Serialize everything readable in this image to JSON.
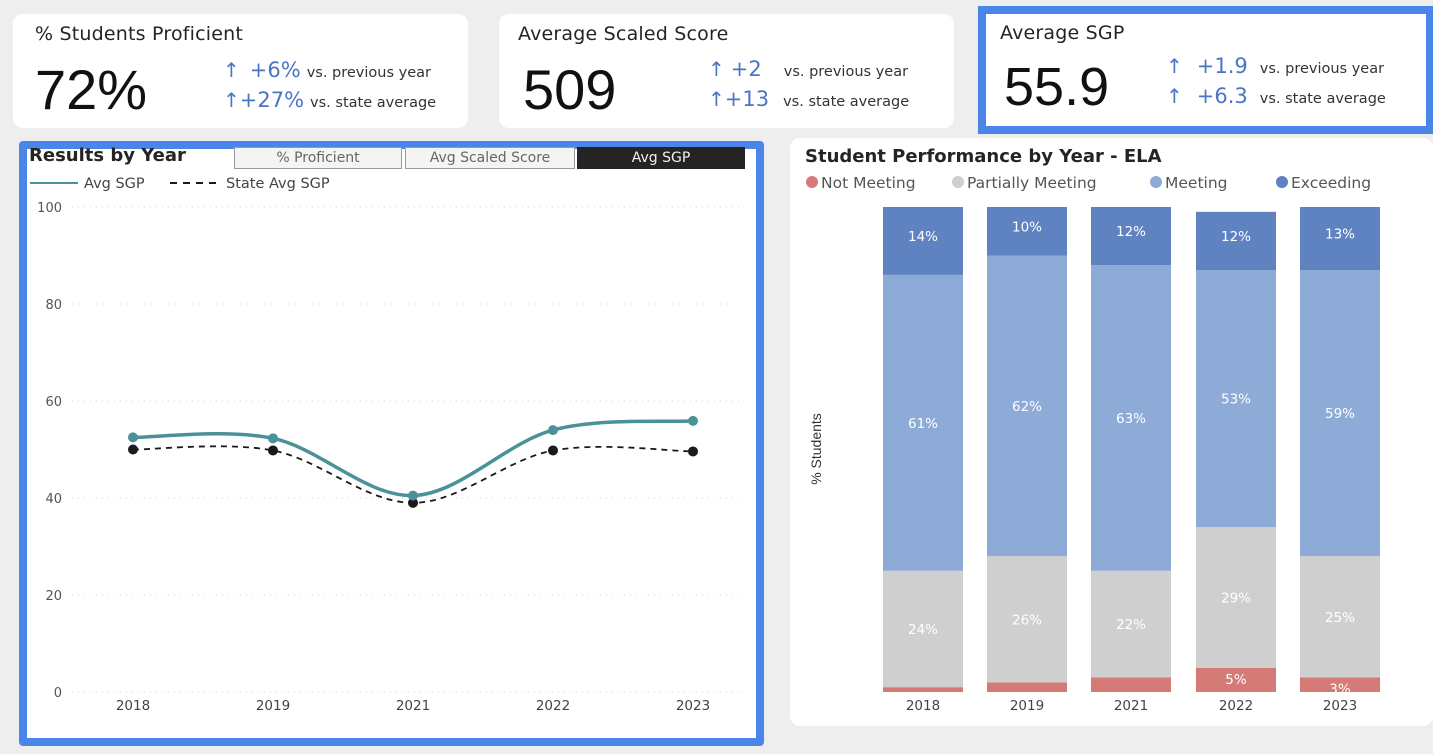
{
  "kpis": [
    {
      "title": "% Students Proficient",
      "value": "72%",
      "rows": [
        {
          "arrow": "↑",
          "delta": "+6%",
          "context": "vs. previous year"
        },
        {
          "arrow": "↑",
          "delta": "+27%",
          "context": "vs. state average"
        }
      ]
    },
    {
      "title": "Average Scaled Score",
      "value": "509",
      "rows": [
        {
          "arrow": "↑",
          "delta": "+2",
          "context": "vs. previous year"
        },
        {
          "arrow": "↑",
          "delta": "+13",
          "context": "vs. state average"
        }
      ]
    },
    {
      "title": "Average SGP",
      "value": "55.9",
      "rows": [
        {
          "arrow": "↑",
          "delta": "+1.9",
          "context": "vs. previous year"
        },
        {
          "arrow": "↑",
          "delta": "+6.3",
          "context": "vs. state average"
        }
      ]
    }
  ],
  "results_panel": {
    "title": "Results by Year",
    "tabs": [
      "% Proficient",
      "Avg Scaled Score",
      "Avg SGP"
    ],
    "active_tab": "Avg SGP"
  },
  "colors": {
    "accent": "#4a86e8",
    "teal": "#4a9297",
    "state": "#1a1a1a",
    "not_meeting": "#d47b78",
    "partially": "#cfcfcf",
    "meeting": "#8eaad7",
    "exceeding": "#5f82c0"
  },
  "chart_data": [
    {
      "type": "line",
      "title": "Results by Year",
      "x": [
        "2018",
        "2019",
        "2021",
        "2022",
        "2023"
      ],
      "ylim": [
        0,
        100
      ],
      "yticks": [
        0,
        20,
        40,
        60,
        80,
        100
      ],
      "grid": true,
      "legend_position": "top-left",
      "series": [
        {
          "name": "Avg SGP",
          "values": [
            52.5,
            52.3,
            40.5,
            54,
            55.9
          ],
          "style": "solid",
          "markers": true
        },
        {
          "name": "State Avg SGP",
          "values": [
            50,
            49.8,
            39,
            49.8,
            49.6
          ],
          "style": "dashed",
          "markers": true
        }
      ]
    },
    {
      "type": "bar",
      "stacked": true,
      "title": "Student Performance by Year - ELA",
      "ylabel": "% Students",
      "legend_position": "top",
      "categories": [
        "2018",
        "2019",
        "2021",
        "2022",
        "2023"
      ],
      "series": [
        {
          "name": "Not Meeting",
          "values": [
            1,
            2,
            3,
            5,
            3
          ],
          "labels": [
            "",
            "",
            "",
            "5%",
            "3%"
          ]
        },
        {
          "name": "Partially Meeting",
          "values": [
            24,
            26,
            22,
            29,
            25
          ],
          "labels": [
            "24%",
            "26%",
            "22%",
            "29%",
            "25%"
          ]
        },
        {
          "name": "Meeting",
          "values": [
            61,
            62,
            63,
            53,
            59
          ],
          "labels": [
            "61%",
            "62%",
            "63%",
            "53%",
            "59%"
          ]
        },
        {
          "name": "Exceeding",
          "values": [
            14,
            10,
            12,
            12,
            13
          ],
          "labels": [
            "14%",
            "10%",
            "12%",
            "12%",
            "13%"
          ]
        }
      ]
    }
  ]
}
